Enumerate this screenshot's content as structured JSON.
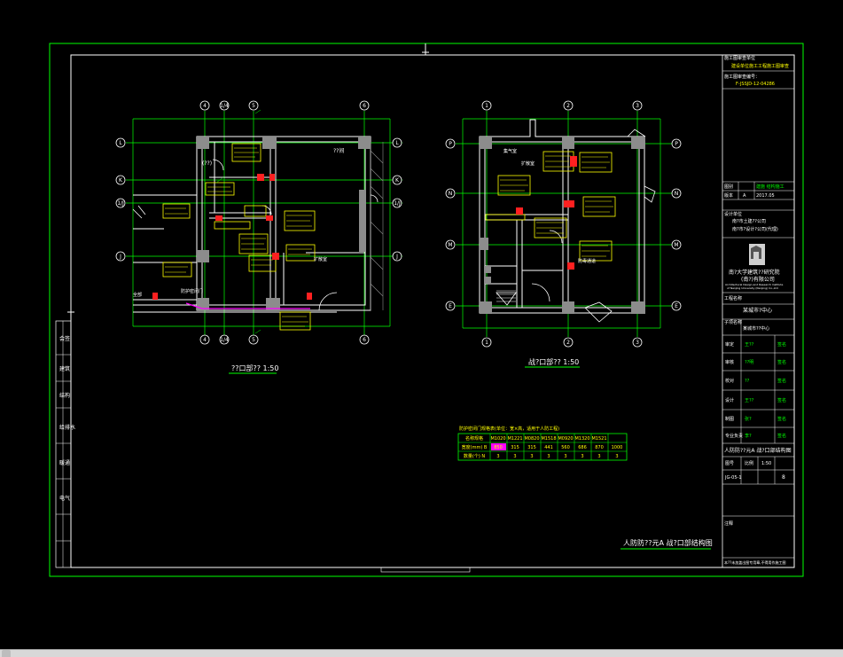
{
  "window": {
    "background": "#000000",
    "frame_color": "#00ff00",
    "line_color": "#ffffff",
    "grid_color": "#00ff00",
    "wall_color": "#8c8c8c",
    "tag_color": "#ffff00",
    "accent_red": "#ff2020",
    "accent_magenta": "#ff00ff"
  },
  "plans": {
    "left": {
      "title": "??口部?? 1:50",
      "axis_top": [
        "4",
        "1/4",
        "5",
        "6"
      ],
      "axis_bottom": [
        "4",
        "1/4",
        "5",
        "6"
      ],
      "axis_left": [
        "L",
        "K",
        "1/J",
        "J"
      ],
      "axis_right": [
        "L",
        "K",
        "1/J",
        "J"
      ],
      "room_label": "??间",
      "labels": [
        "(??)",
        "全部",
        "防护密闭门",
        "滤毒室",
        "扩散室"
      ]
    },
    "right": {
      "title": "战?口部?? 1:50",
      "axis_top": [
        "1",
        "2",
        "3"
      ],
      "axis_bottom": [
        "1",
        "2",
        "3"
      ],
      "axis_left": [
        "P",
        "N",
        "M",
        "E"
      ],
      "axis_right": [
        "P",
        "N",
        "M",
        "E"
      ],
      "labels": [
        "集气室",
        "防毒通道",
        "扩散室"
      ]
    }
  },
  "schedule": {
    "title": "防护密闭门规格表(单位：宽×高，适用于人防工程)",
    "headers": [
      "名称规格",
      "M1020",
      "M1221",
      "M0820",
      "M1518",
      "M0920",
      "M1320",
      "M1521"
    ],
    "row1_label": "宽度(mm) B",
    "row1": [
      "850",
      "315",
      "315",
      "441",
      "560",
      "686",
      "870",
      "1000"
    ],
    "row2_label": "数量(个) N",
    "row2": [
      "3",
      "3",
      "3",
      "3",
      "3",
      "3",
      "3",
      "3"
    ]
  },
  "bottom_caption": "人防防??元A  战?口部结构图",
  "title_block": {
    "top_title": "施工图审查单位",
    "top_line": "建设单位施工工程施工图审查",
    "cert_label": "施工图审查编号：",
    "cert_no": "F-JSSJD-12-04286",
    "row_a": [
      "图别",
      "建施 结构施工"
    ],
    "row_b": [
      "版本",
      "A",
      "2017.05"
    ],
    "design_label": "设计单位",
    "company1": "南?市土建??公司",
    "company2": "南?市?设计?公司(代理)",
    "inst_name1": "南?大学建筑??研究院",
    "inst_name2": "(南?)有限公司",
    "inst_en1": "Architectural Design and Research Institute",
    "inst_en2": "of Nanjing University (Nanjing) Co.,Ltd",
    "project_label": "工程名称",
    "project": "某城市?中心",
    "sub_label": "子项名称",
    "sub": "某城市??中心",
    "roles": [
      {
        "role": "审定",
        "name": "王??",
        "sig": "签名"
      },
      {
        "role": "审核",
        "name": "??明",
        "sig": "签名"
      },
      {
        "role": "校对",
        "name": "??",
        "sig": "签名"
      },
      {
        "role": "设计",
        "name": "王??",
        "sig": "签名"
      },
      {
        "role": "制图",
        "name": "张?",
        "sig": "签名"
      },
      {
        "role": "专业负责",
        "name": "李?",
        "sig": "签名"
      }
    ],
    "drawing_name": "人防防??元A  战?口部结构图",
    "drawing_no_label": "图号",
    "drawing_no": "JG-05-1",
    "scale_label": "比例",
    "scale": "1:50",
    "sheet": "8",
    "notes_label": "注释",
    "footer": "本??未加盖出图专用章,不得用作施工图"
  },
  "left_strip": [
    "会签",
    "建筑",
    "结构",
    "给排水",
    "暖通",
    "电气"
  ]
}
